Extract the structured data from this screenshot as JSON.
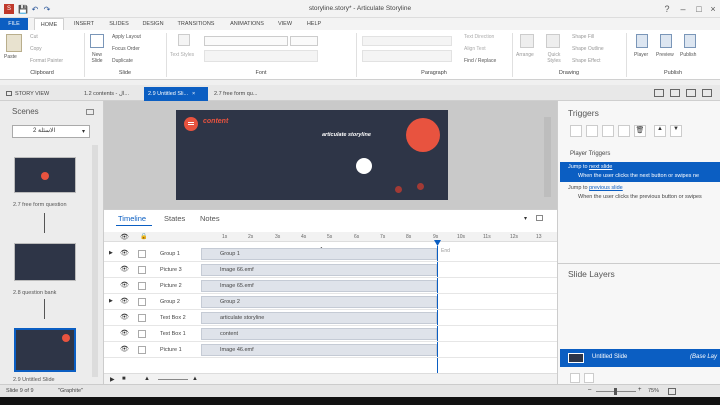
{
  "window": {
    "title": "storyline.story* - Articulate Storyline"
  },
  "menu": [
    "FILE",
    "HOME",
    "INSERT",
    "SLIDES",
    "DESIGN",
    "TRANSITIONS",
    "ANIMATIONS",
    "VIEW",
    "HELP"
  ],
  "ribbon": {
    "clipboard": {
      "label": "Clipboard",
      "paste": "Paste",
      "cut": "Cut",
      "copy": "Copy",
      "format_painter": "Format Painter"
    },
    "slide": {
      "label": "Slide",
      "new_slide": "New Slide",
      "apply_layout": "Apply Layout",
      "focus_order": "Focus Order",
      "duplicate": "Duplicate"
    },
    "font": {
      "label": "Font",
      "text_styles": "Text Styles"
    },
    "paragraph": {
      "label": "Paragraph",
      "text_direction": "Text Direction",
      "align_text": "Align Text",
      "find_replace": "Find / Replace"
    },
    "drawing": {
      "label": "Drawing",
      "arrange": "Arrange",
      "quick_styles": "Quick Styles",
      "shape_fill": "Shape Fill",
      "shape_outline": "Shape Outline",
      "shape_effect": "Shape Effect"
    },
    "publish": {
      "label": "Publish",
      "player": "Player",
      "preview": "Preview",
      "publish": "Publish"
    }
  },
  "tabs": {
    "story_view": "STORY VIEW",
    "tab1": "1.2 contents - ال...",
    "tab2": "2.9 Untitled Sli...",
    "tab3": "2.7 free form qu..."
  },
  "scenes": {
    "title": "Scenes",
    "dropdown": "الاسئلة 2",
    "thumbs": [
      {
        "label": "2.7 free form question"
      },
      {
        "label": "2.8 question bank"
      },
      {
        "label": "2.9 Untitled Slide"
      }
    ]
  },
  "slide": {
    "content_title": "content",
    "subtitle": "articulate storyline"
  },
  "timeline": {
    "tabs": [
      "Timeline",
      "States",
      "Notes"
    ],
    "ticks": [
      "1s",
      "2s",
      "3s",
      "4s",
      "5s",
      "6s",
      "7s",
      "8s",
      "9s",
      "10s",
      "11s",
      "12s",
      "13"
    ],
    "end_label": "End",
    "rows": [
      {
        "name": "Group 1",
        "bar": "Group 1"
      },
      {
        "name": "Picture 3",
        "bar": "Image 66.emf"
      },
      {
        "name": "Picture 2",
        "bar": "Image 65.emf"
      },
      {
        "name": "Group 2",
        "bar": "Group 2"
      },
      {
        "name": "Text Box 2",
        "bar": "articulate storyline"
      },
      {
        "name": "Text Box 1",
        "bar": "content"
      },
      {
        "name": "Picture 1",
        "bar": "Image 46.emf"
      }
    ]
  },
  "triggers": {
    "title": "Triggers",
    "player_triggers": "Player Triggers",
    "t1": {
      "jump": "Jump to",
      "link": "next slide",
      "when": "When the user clicks the next button or swipes ne"
    },
    "t2": {
      "jump": "Jump to",
      "link": "previous slide",
      "when": "When the user clicks the previous button or swipes"
    },
    "slide_layers": "Slide Layers",
    "base_layer": "Untitled Slide",
    "base_layer_tag": "(Base Lay"
  },
  "status": {
    "slide": "Slide 9 of 9",
    "theme": "\"Graphite\"",
    "zoom": "75%"
  },
  "colors": {
    "accent": "#0b5ec2",
    "slide_bg": "#2e3547",
    "circle": "#e8533f"
  }
}
